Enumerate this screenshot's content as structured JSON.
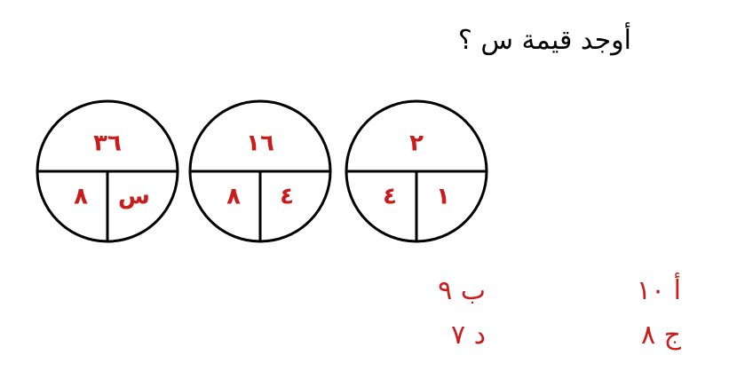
{
  "question": "أوجد قيمة س ؟",
  "circles": [
    {
      "top": "٣٦",
      "bottom_left": "٨",
      "bottom_right": "س"
    },
    {
      "top": "١٦",
      "bottom_left": "٨",
      "bottom_right": "٤"
    },
    {
      "top": "٢",
      "bottom_left": "٤",
      "bottom_right": "١"
    }
  ],
  "choices": {
    "a": "أ ١٠",
    "b": "ب ٩",
    "c": "ج ٨",
    "d": "د ٧"
  },
  "colors": {
    "accent": "#cc1b1b",
    "text": "#000000"
  }
}
